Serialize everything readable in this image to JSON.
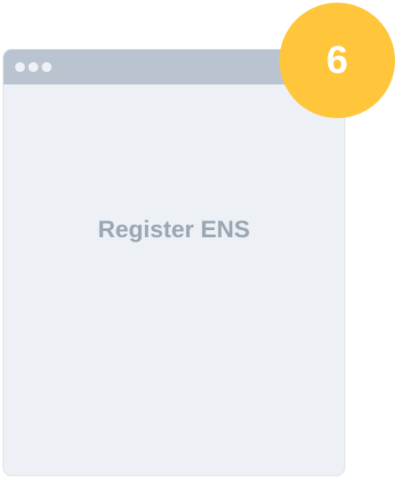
{
  "window": {
    "label": "Register ENS"
  },
  "badge": {
    "step": "6"
  },
  "colors": {
    "window_background": "#edf0f5",
    "title_bar": "#b9c4d0",
    "label_text": "#9ba7b2",
    "badge": "#ffc63b",
    "badge_text": "#ffffff"
  }
}
